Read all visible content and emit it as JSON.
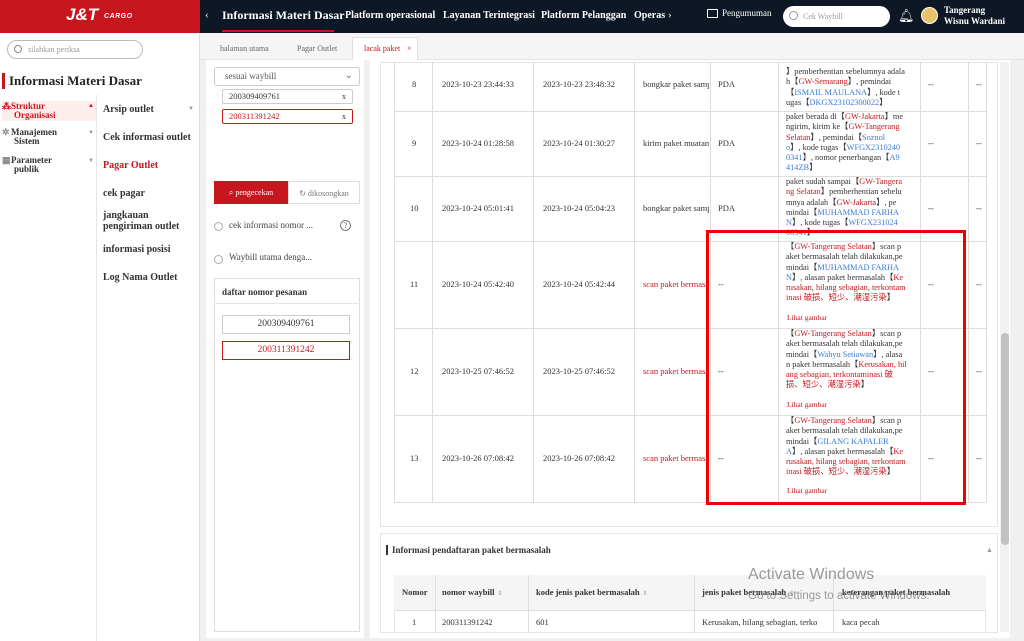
{
  "brand": {
    "logo_main": "J&T",
    "logo_sub": "CARGO",
    "accent": "#c7161d",
    "topbar_bg": "#0d1726"
  },
  "nav": {
    "prev_icon": "chevron-left-icon",
    "next_icon": "chevron-right-icon",
    "items": [
      "Informasi Materi Dasar",
      "Platform operasional",
      "Layanan Terintegrasi",
      "Platform Pelanggan",
      "Operas"
    ],
    "announcement": "Pengumuman",
    "search_placeholder": "Cek Waybill",
    "user_line1": "Tangerang",
    "user_line2": "Wisnu Wardani"
  },
  "sidebar": {
    "search_placeholder": "silahkan periksa",
    "title": "Informasi Materi Dasar",
    "level1": [
      {
        "label_line1": "Struktur",
        "label_line2": "Organisasi",
        "icon": "org-icon",
        "active": true
      },
      {
        "label_line1": "Manajemen",
        "label_line2": "Sistem",
        "icon": "gear-icon",
        "active": false
      },
      {
        "label_line1": "Parameter",
        "label_line2": "publik",
        "icon": "grid-icon",
        "active": false
      }
    ],
    "level2": [
      {
        "label": "Arsip outlet",
        "has_caret": true
      },
      {
        "label": "Cek informasi outlet"
      },
      {
        "label": "Pagar Outlet",
        "active": true
      },
      {
        "label": "cek pagar"
      },
      {
        "label_line1": "jangkauan",
        "label_line2": "pengiriman outlet"
      },
      {
        "label": "informasi posisi"
      },
      {
        "label": "Log Nama Outlet"
      }
    ]
  },
  "tabs": [
    {
      "label": "halaman utama"
    },
    {
      "label": "Pagar Outlet"
    },
    {
      "label": "lacak paket",
      "active": true,
      "close": "×"
    }
  ],
  "filter": {
    "select_value": "sesuai waybill",
    "waybills": [
      "200309409761",
      "200311391242"
    ],
    "remove": "x",
    "search_button": "pengecekan",
    "clear_button": "dikosongkan",
    "radio1": "cek informasi nomor ...",
    "radio2": "Waybill utama denga...",
    "help": "?",
    "order_list_title": "daftar nomor pesanan",
    "orders": [
      "200309409761",
      "200311391242"
    ]
  },
  "track_rows": [
    {
      "no": "8",
      "t1": "2023-10-23 23:44:33",
      "t2": "2023-10-23 23:48:32",
      "type": "bongkar paket samp",
      "src": "PDA",
      "desc_html": "】pemberhentian sebelumnya adala<br>h【<span class='r'>GW-Semarang</span>】, pemindai<br>【<span class='b'>ISMAIL MAULANA</span>】, kode t<br>ugas【<span class='b'>DKGX23102300022</span>】",
      "e1": "--",
      "e2": "--"
    },
    {
      "no": "9",
      "t1": "2023-10-24 01:28:58",
      "t2": "2023-10-24 01:30:27",
      "type": "kirim paket muatan",
      "src": "PDA",
      "desc_html": "paket berada di【<span class='r'>GW-Jakarta</span>】me<br>ngirim, kirim ke【<span class='r'>GW-Tangerang</span><br><span class='r'>Selatan</span>】, pemindai【<span class='b'>Soznol</span><br><span class='b'>o</span>】, kode tugas【<span class='b'>WFGX2310240</span><br><span class='b'>0341</span>】, nomor penerbangan【<span class='b'>A9</span><br><span class='b'>414ZB</span>】",
      "e1": "--",
      "e2": "--"
    },
    {
      "no": "10",
      "t1": "2023-10-24 05:01:41",
      "t2": "2023-10-24 05:04:23",
      "type": "bongkar paket samp",
      "src": "PDA",
      "desc_html": "paket sudah sampai【<span class='r'>GW-Tangera</span><br><span class='r'>ng Selatan</span>】pemberhentian sebelu<br>mnya adalah【<span class='r'>GW-Jakarta</span>】, pe<br>mindai【<span class='b'>MUHAMMAD FARHA</span><br><span class='b'>N</span>】, kode tugas【<span class='b'>WFGX231024</span><br><span class='b'>00341</span>】",
      "e1": "--",
      "e2": "--"
    },
    {
      "no": "11",
      "t1": "2023-10-24 05:42:40",
      "t2": "2023-10-24 05:42:44",
      "type": "scan paket bermasal",
      "type_red": true,
      "src": "--",
      "desc_html": "【<span class='r'>GW-Tangerang Selatan</span>】scan p<br>aket bermasalah telah dilakukan,pe<br>mindai【<span class='b'>MUHAMMAD FARHA</span><br><span class='b'>N</span>】, alasan paket bermasalah【<span class='r'>Ke</span><br><span class='r'>rusakan, hilang sebagian, terkontam</span><br><span class='r'>inasi 破损、短少、潮湿污染</span>】",
      "lihat": "Lihat gambar",
      "e1": "--",
      "e2": "--"
    },
    {
      "no": "12",
      "t1": "2023-10-25 07:46:52",
      "t2": "2023-10-25 07:46:52",
      "type": "scan paket bermasal",
      "type_red": true,
      "src": "--",
      "desc_html": "【<span class='r'>GW-Tangerang Selatan</span>】scan p<br>aket bermasalah telah dilakukan,pe<br>mindai【<span class='b'>Wahyu Setiawan</span>】, alasa<br>n paket bermasalah【<span class='r'>Kerusakan, hil</span><br><span class='r'>ang sebagian, terkontaminasi 破</span><br><span class='r'>损、短少、潮湿污染</span>】",
      "lihat": "Lihat gambar",
      "e1": "--",
      "e2": "--"
    },
    {
      "no": "13",
      "t1": "2023-10-26 07:08:42",
      "t2": "2023-10-26 07:08:42",
      "type": "scan paket bermasal",
      "type_red": true,
      "src": "--",
      "desc_html": "【<span class='r'>GW-Tangerang Selatan</span>】scan p<br>aket bermasalah telah dilakukan,pe<br>mindai【<span class='b'>GILANG KAPALER</span><br><span class='b'>A</span>】, alasan paket bermasalah【<span class='r'>Ke</span><br><span class='r'>rusakan, hilang sebagian, terkontam</span><br><span class='r'>inasi 破损、短少、潮湿污染</span>】",
      "lihat": "Lihat gambar",
      "e1": "--",
      "e2": "--"
    }
  ],
  "problem_section": {
    "title": "Informasi pendaftaran paket bermasalah",
    "headers": [
      "Nomor",
      "nomor waybill",
      "kode jenis paket bermasalah",
      "jenis paket bermasalah",
      "keterangan paket bermasalah"
    ],
    "row": [
      "1",
      "200311391242",
      "601",
      "Kerusakan, hilang sebagian, terko",
      "kaca pecah"
    ]
  },
  "windows_watermark": {
    "line1": "Activate Windows",
    "line2": "Go to Settings to activate Windows."
  }
}
